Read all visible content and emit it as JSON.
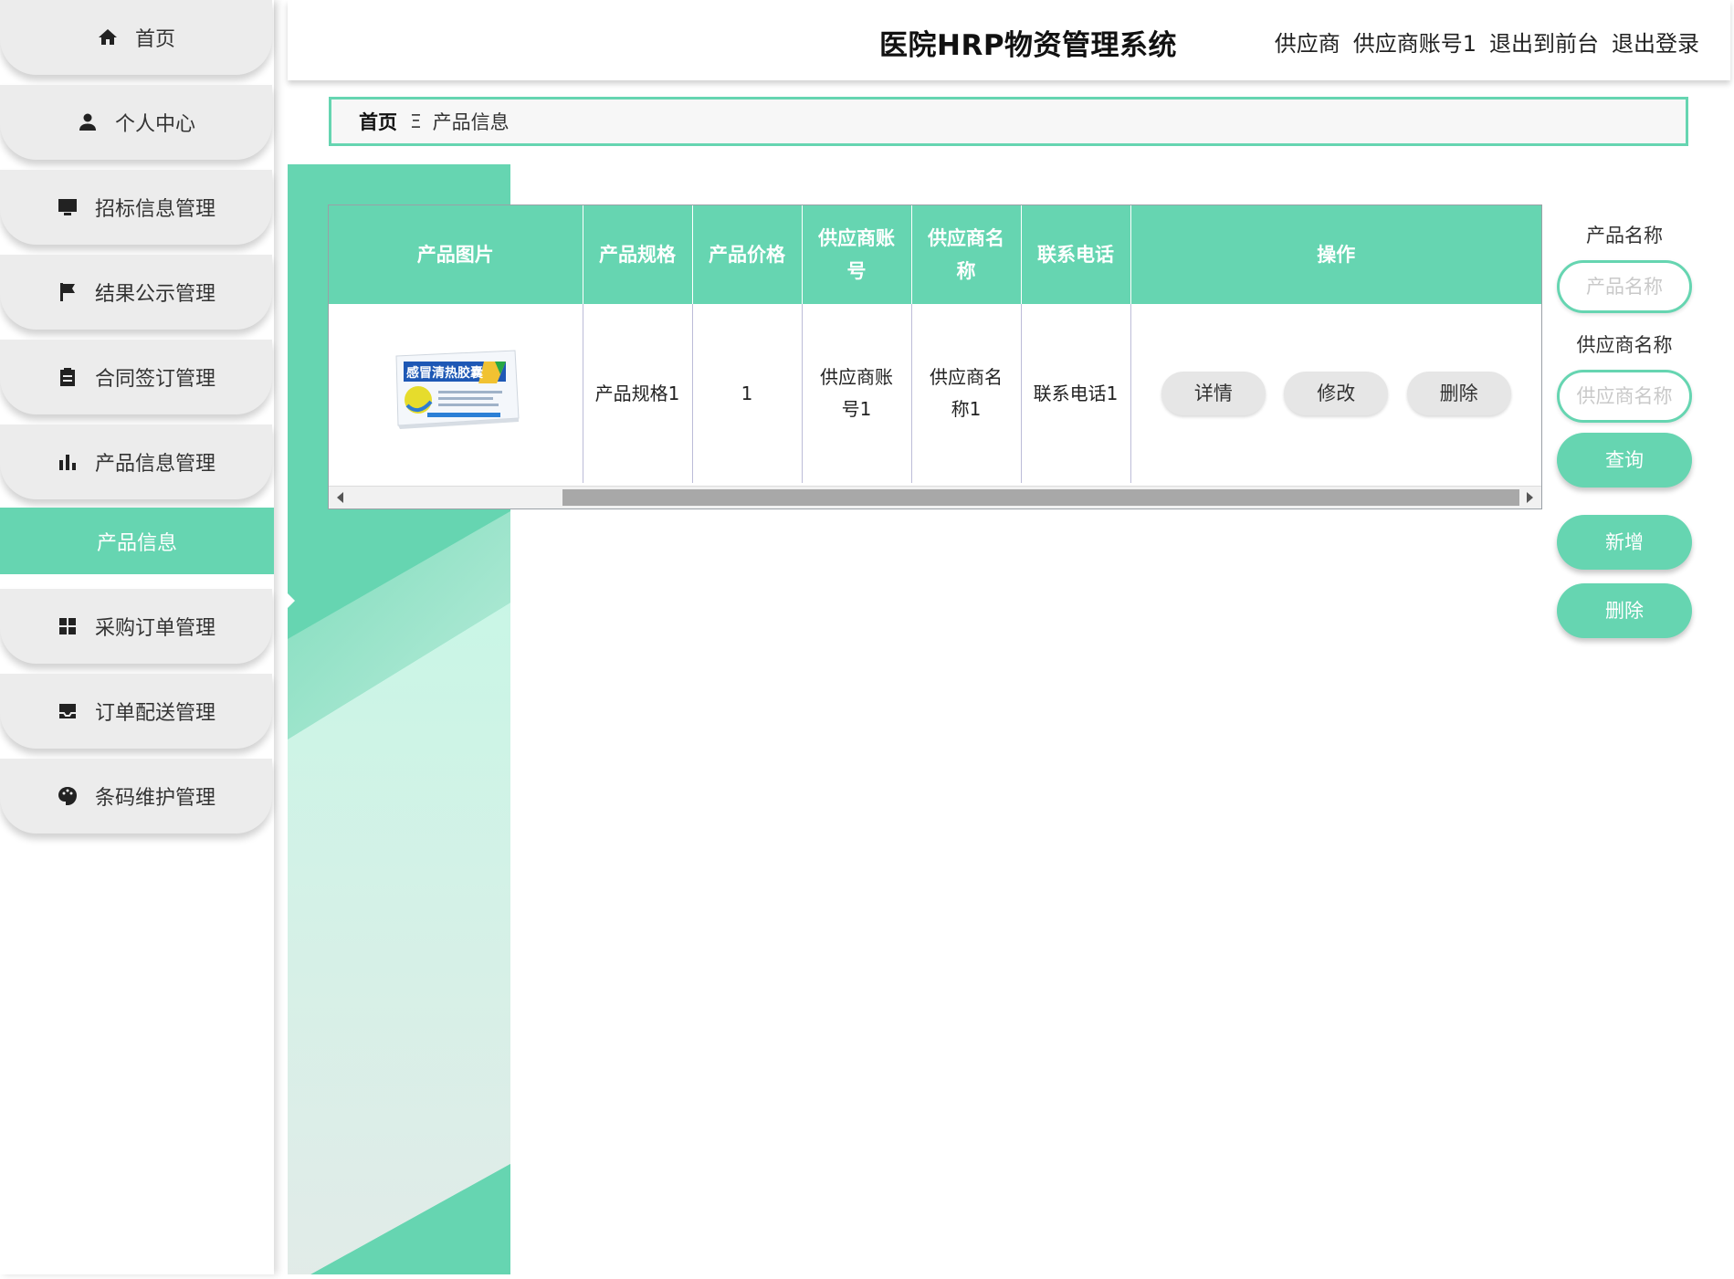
{
  "header": {
    "app_title": "医院HRP物资管理系统",
    "role": "供应商",
    "username": "供应商账号1",
    "to_frontend": "退出到前台",
    "logout": "退出登录"
  },
  "sidebar": {
    "items": [
      {
        "label": "首页",
        "icon": "home-icon"
      },
      {
        "label": "个人中心",
        "icon": "person-icon"
      },
      {
        "label": "招标信息管理",
        "icon": "monitor-icon"
      },
      {
        "label": "结果公示管理",
        "icon": "flag-icon"
      },
      {
        "label": "合同签订管理",
        "icon": "clipboard-icon"
      },
      {
        "label": "产品信息管理",
        "icon": "bar-chart-icon"
      },
      {
        "label": "采购订单管理",
        "icon": "grid-icon"
      },
      {
        "label": "订单配送管理",
        "icon": "inbox-icon"
      },
      {
        "label": "条码维护管理",
        "icon": "palette-icon"
      }
    ],
    "active_submenu": "产品信息"
  },
  "breadcrumb": {
    "home": "首页",
    "separator": "Ξ",
    "current": "产品信息"
  },
  "table": {
    "columns": [
      "产品图片",
      "产品规格",
      "产品价格",
      "供应商账号",
      "供应商名称",
      "联系电话",
      "操作"
    ],
    "rows": [
      {
        "image_text": "感冒清热胶囊",
        "spec": "产品规格1",
        "price": "1",
        "supplier_account": "供应商账号1",
        "supplier_name": "供应商名称1",
        "phone": "联系电话1",
        "actions": [
          "详情",
          "修改",
          "删除"
        ]
      }
    ]
  },
  "search": {
    "product_name_label": "产品名称",
    "product_name_placeholder": "产品名称",
    "product_name_value": "",
    "supplier_name_label": "供应商名称",
    "supplier_name_placeholder": "供应商名称",
    "supplier_name_value": "",
    "query_button": "查询",
    "add_button": "新增",
    "delete_button": "删除"
  },
  "colors": {
    "accent": "#66d5b1",
    "menu_bg": "#ececec",
    "action_btn_bg": "#e6e6e6"
  }
}
